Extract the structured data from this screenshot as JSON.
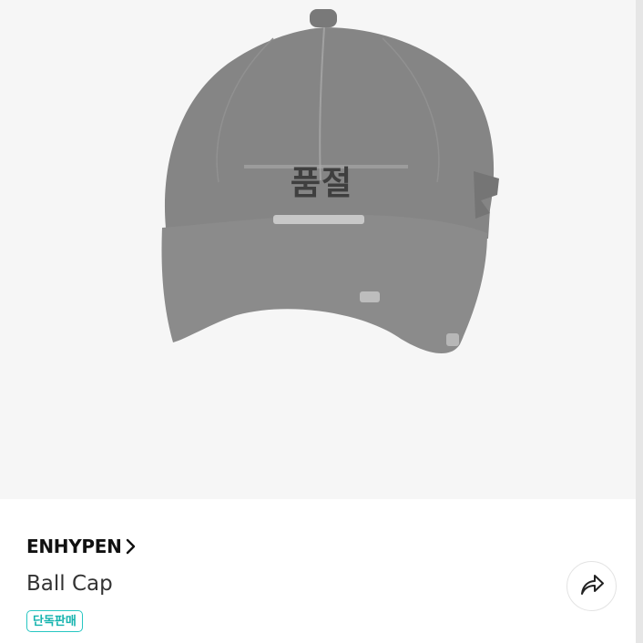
{
  "product": {
    "status_overlay": "품절",
    "brand": "ENHYPEN",
    "name": "Ball Cap",
    "badge": "단독판매"
  },
  "icons": {
    "brand_link": "chevron-right-icon",
    "share": "share-arrow-icon"
  },
  "colors": {
    "hero_background": "#f6f6f6",
    "badge_accent": "#27c6c2",
    "cap_overlay": "#7c7c7c"
  }
}
